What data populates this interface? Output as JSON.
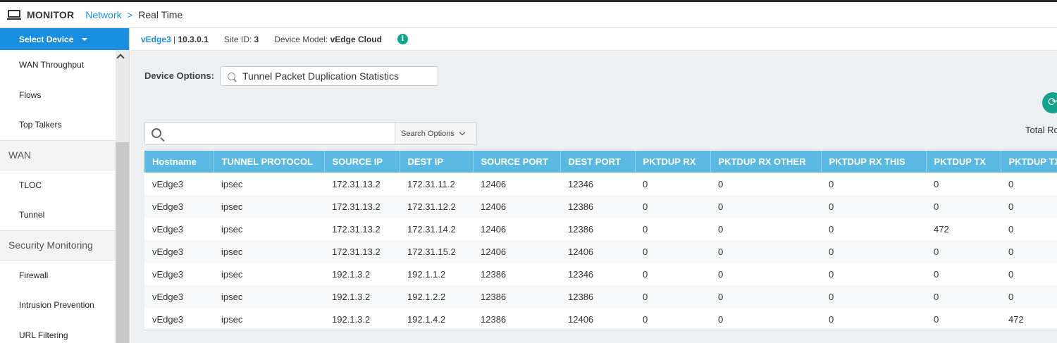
{
  "header": {
    "app_title": "MONITOR",
    "breadcrumb_link": "Network",
    "breadcrumb_sep": ">",
    "breadcrumb_current": "Real Time"
  },
  "sidebar": {
    "select_device": "Select Device",
    "items": [
      {
        "label": "WAN Throughput",
        "type": "item"
      },
      {
        "label": "Flows",
        "type": "item"
      },
      {
        "label": "Top Talkers",
        "type": "item"
      },
      {
        "label": "WAN",
        "type": "group"
      },
      {
        "label": "TLOC",
        "type": "item"
      },
      {
        "label": "Tunnel",
        "type": "item"
      },
      {
        "label": "Security Monitoring",
        "type": "group"
      },
      {
        "label": "Firewall",
        "type": "item"
      },
      {
        "label": "Intrusion Prevention",
        "type": "item"
      },
      {
        "label": "URL Filtering",
        "type": "item"
      }
    ]
  },
  "device_bar": {
    "device_name": "vEdge3",
    "separator": " | ",
    "system_ip": "10.3.0.1",
    "site_id_label": "Site ID: ",
    "site_id": "3",
    "model_label": "Device Model: ",
    "model": "vEdge Cloud",
    "info_glyph": "i"
  },
  "options": {
    "label": "Device Options:",
    "value": "Tunnel Packet Duplication Statistics"
  },
  "refresh_glyph": "⟳",
  "total_rows_label": "Total Ro",
  "search": {
    "placeholder": "",
    "options_label": "Search Options"
  },
  "table": {
    "columns": [
      "Hostname",
      "TUNNEL PROTOCOL",
      "SOURCE IP",
      "DEST IP",
      "SOURCE PORT",
      "DEST PORT",
      "PKTDUP RX",
      "PKTDUP RX OTHER",
      "PKTDUP RX THIS",
      "PKTDUP TX",
      "PKTDUP TX"
    ],
    "rows": [
      [
        "vEdge3",
        "ipsec",
        "172.31.13.2",
        "172.31.11.2",
        "12406",
        "12346",
        "0",
        "0",
        "0",
        "0",
        "0"
      ],
      [
        "vEdge3",
        "ipsec",
        "172.31.13.2",
        "172.31.12.2",
        "12406",
        "12386",
        "0",
        "0",
        "0",
        "0",
        "0"
      ],
      [
        "vEdge3",
        "ipsec",
        "172.31.13.2",
        "172.31.14.2",
        "12406",
        "12386",
        "0",
        "0",
        "0",
        "472",
        "0"
      ],
      [
        "vEdge3",
        "ipsec",
        "172.31.13.2",
        "172.31.15.2",
        "12406",
        "12406",
        "0",
        "0",
        "0",
        "0",
        "0"
      ],
      [
        "vEdge3",
        "ipsec",
        "192.1.3.2",
        "192.1.1.2",
        "12386",
        "12346",
        "0",
        "0",
        "0",
        "0",
        "0"
      ],
      [
        "vEdge3",
        "ipsec",
        "192.1.3.2",
        "192.1.2.2",
        "12386",
        "12386",
        "0",
        "0",
        "0",
        "0",
        "0"
      ],
      [
        "vEdge3",
        "ipsec",
        "192.1.3.2",
        "192.1.4.2",
        "12386",
        "12406",
        "0",
        "0",
        "0",
        "0",
        "472"
      ]
    ]
  }
}
